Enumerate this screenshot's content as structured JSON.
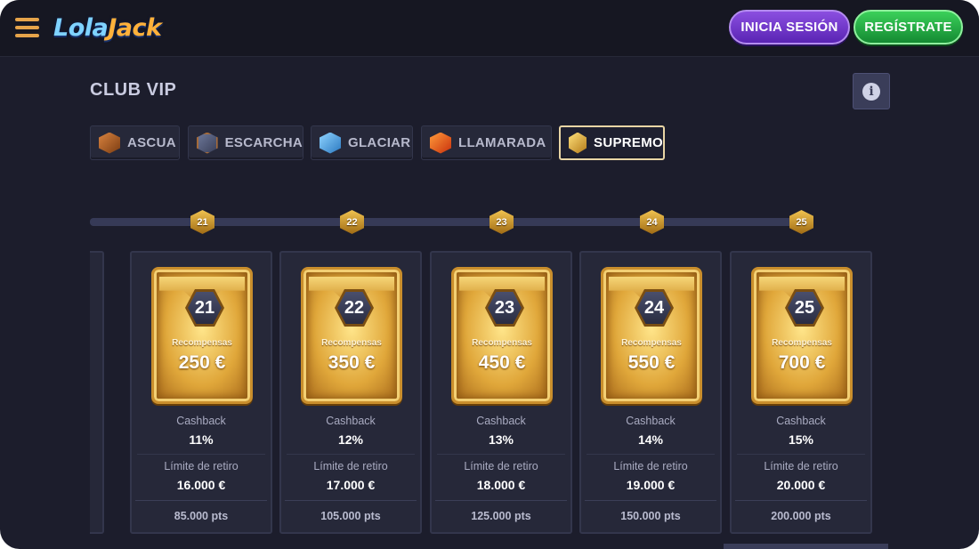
{
  "header": {
    "menu_icon": "hamburger-menu-icon",
    "logo_part1": "Lola",
    "logo_part2": "Jack",
    "login_label": "INICIA SESIÓN",
    "register_label": "REGÍSTRATE"
  },
  "page": {
    "title": "CLUB VIP",
    "info_icon": "info-icon",
    "info_glyph": "i"
  },
  "tiers": [
    {
      "label": "ASCUA",
      "color": "#b8632a",
      "active": false
    },
    {
      "label": "ESCARCHA",
      "color": "#4d5573",
      "active": false
    },
    {
      "label": "GLACIAR",
      "color": "#4aa3e0",
      "active": false
    },
    {
      "label": "LLAMARADA",
      "color": "#f0561c",
      "active": false
    },
    {
      "label": "SUPREMO",
      "color": "#e8b43c",
      "active": true
    }
  ],
  "levels": [
    {
      "level": "21",
      "rewards_label": "Recompensas",
      "reward": "250 €",
      "cashback_label": "Cashback",
      "cashback": "11%",
      "limit_label": "Límite de retiro",
      "limit": "16.000 €",
      "points": "85.000 pts"
    },
    {
      "level": "22",
      "rewards_label": "Recompensas",
      "reward": "350 €",
      "cashback_label": "Cashback",
      "cashback": "12%",
      "limit_label": "Límite de retiro",
      "limit": "17.000 €",
      "points": "105.000 pts"
    },
    {
      "level": "23",
      "rewards_label": "Recompensas",
      "reward": "450 €",
      "cashback_label": "Cashback",
      "cashback": "13%",
      "limit_label": "Límite de retiro",
      "limit": "18.000 €",
      "points": "125.000 pts"
    },
    {
      "level": "24",
      "rewards_label": "Recompensas",
      "reward": "550 €",
      "cashback_label": "Cashback",
      "cashback": "14%",
      "limit_label": "Límite de retiro",
      "limit": "19.000 €",
      "points": "150.000 pts"
    },
    {
      "level": "25",
      "rewards_label": "Recompensas",
      "reward": "700 €",
      "cashback_label": "Cashback",
      "cashback": "15%",
      "limit_label": "Límite de retiro",
      "limit": "20.000 €",
      "points": "200.000 pts"
    }
  ],
  "colors": {
    "accent_gold": "#e8b43c",
    "login_purple": "#7a3ad0",
    "register_green": "#22b043",
    "background": "#1c1d2c"
  }
}
